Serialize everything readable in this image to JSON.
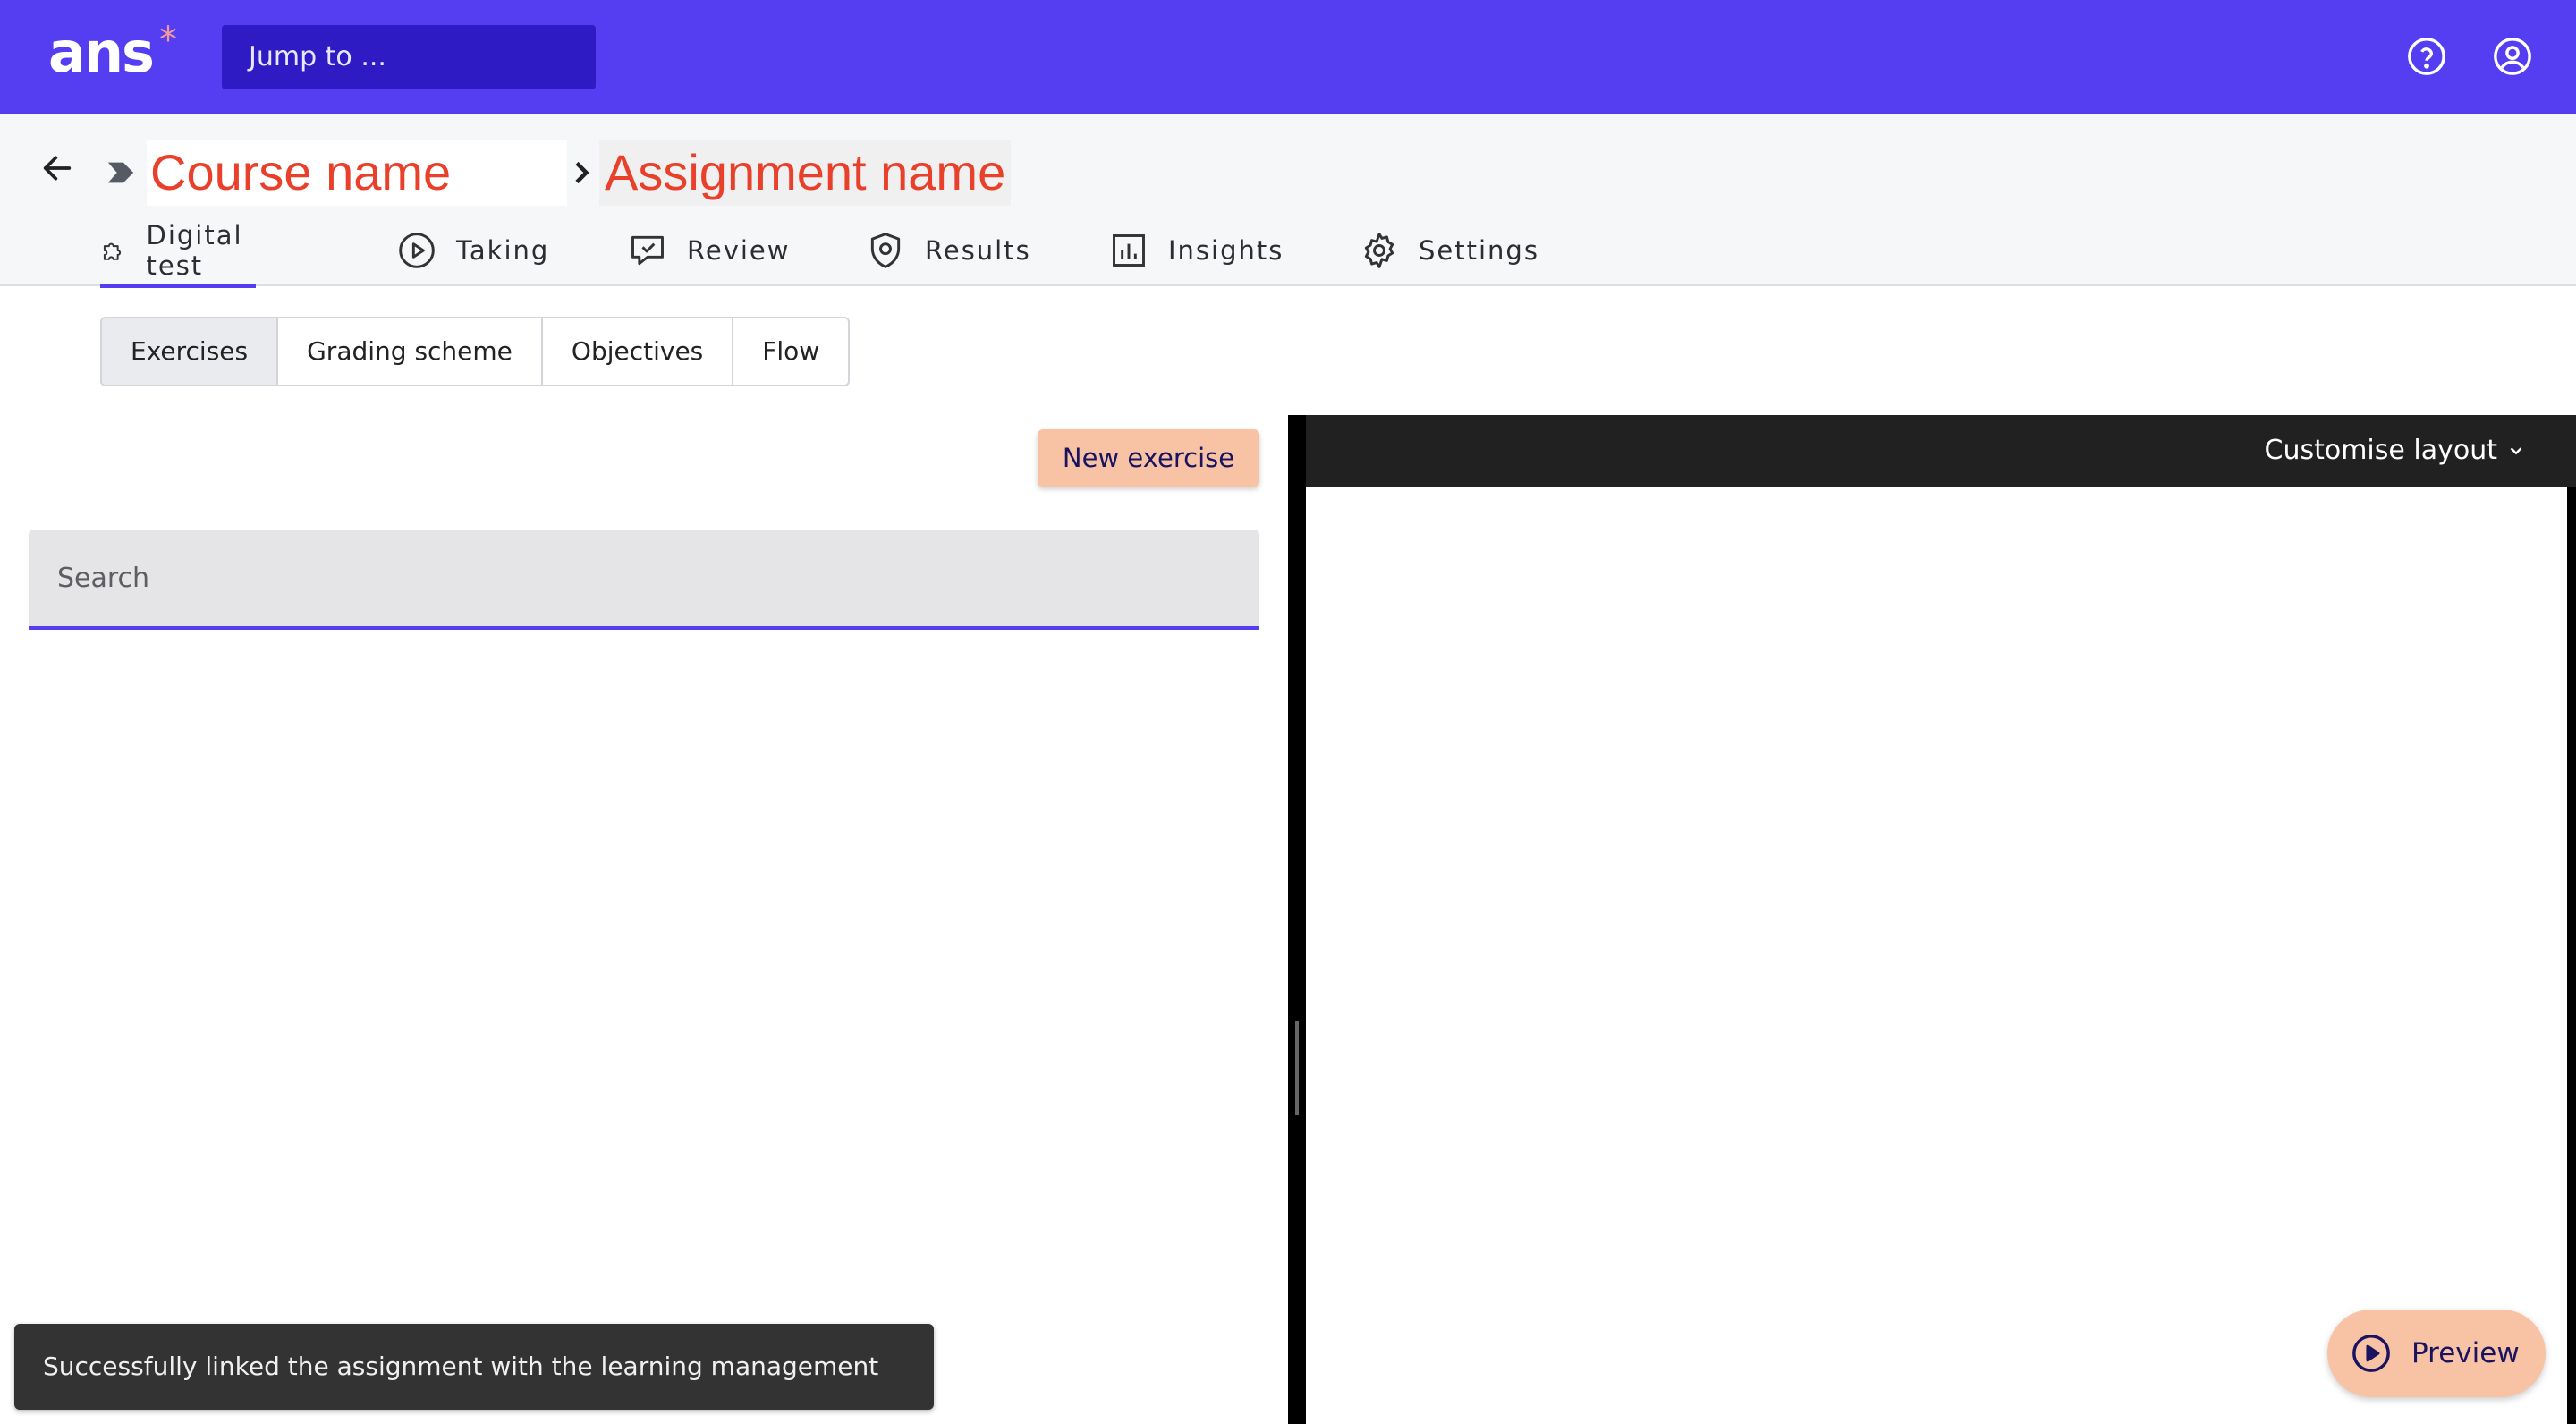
{
  "app": {
    "logo": "ans",
    "logo_mark": "*"
  },
  "topbar": {
    "jump_placeholder": "Jump to ..."
  },
  "breadcrumb": {
    "course": "Course name",
    "assignment": "Assignment name"
  },
  "tabs": [
    {
      "label": "Digital test",
      "icon": "puzzle-icon",
      "active": true
    },
    {
      "label": "Taking",
      "icon": "play-circle-icon"
    },
    {
      "label": "Review",
      "icon": "comment-check-icon"
    },
    {
      "label": "Results",
      "icon": "shield-icon"
    },
    {
      "label": "Insights",
      "icon": "bar-chart-icon"
    },
    {
      "label": "Settings",
      "icon": "gear-icon"
    }
  ],
  "subtabs": [
    "Exercises",
    "Grading scheme",
    "Objectives",
    "Flow"
  ],
  "left": {
    "new_exercise": "New exercise",
    "search_placeholder": "Search"
  },
  "right": {
    "customise_layout": "Customise layout"
  },
  "preview_label": "Preview",
  "toast": "Successfully linked the assignment with the learning management system",
  "colors": {
    "brand": "#553df2",
    "accent_button": "#f7c3a4",
    "breadcrumb_text": "#e8402b"
  }
}
